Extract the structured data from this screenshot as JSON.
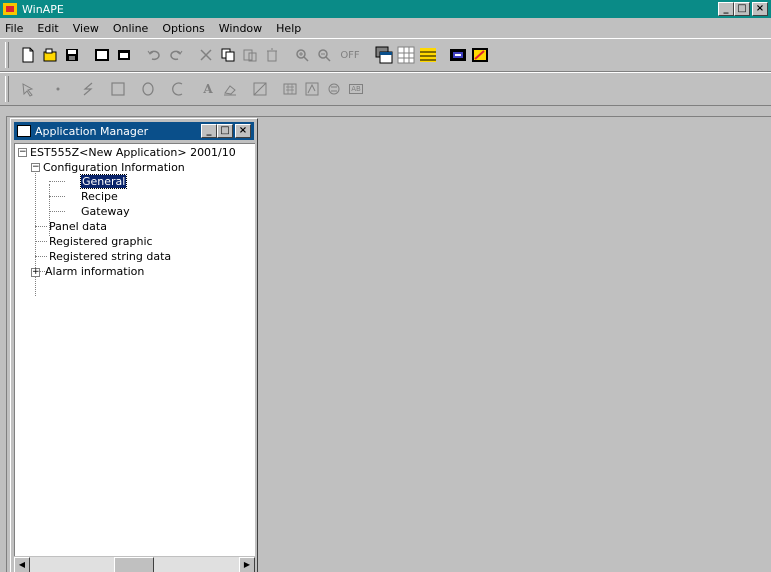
{
  "window": {
    "title": "WinAPE"
  },
  "menu": [
    "File",
    "Edit",
    "View",
    "Online",
    "Options",
    "Window",
    "Help"
  ],
  "toolbar1": [
    {
      "name": "new-icon"
    },
    {
      "name": "open-icon"
    },
    {
      "name": "save-icon"
    },
    {
      "name": "screen-icon"
    },
    {
      "name": "dialog-icon"
    },
    {
      "name": "undo-icon"
    },
    {
      "name": "redo-icon"
    },
    {
      "name": "cut-icon"
    },
    {
      "name": "copy-icon"
    },
    {
      "name": "paste-icon"
    },
    {
      "name": "delete-icon"
    },
    {
      "name": "zoom-in-icon"
    },
    {
      "name": "zoom-out-icon"
    },
    {
      "name": "zoom-off-icon",
      "label": "OFF"
    },
    {
      "name": "overlap-icon"
    },
    {
      "name": "grid-icon"
    },
    {
      "name": "palette-icon"
    },
    {
      "name": "screen-list-icon"
    },
    {
      "name": "property-icon"
    }
  ],
  "toolbar2": [
    {
      "name": "select-arrow-icon"
    },
    {
      "name": "dot-icon"
    },
    {
      "name": "polyline-icon"
    },
    {
      "name": "rectangle-icon"
    },
    {
      "name": "circle-icon"
    },
    {
      "name": "arc-icon"
    },
    {
      "name": "text-icon",
      "label": "A"
    },
    {
      "name": "paint-icon"
    },
    {
      "name": "slash-box-icon"
    },
    {
      "name": "keyboard-icon"
    },
    {
      "name": "lamp-icon"
    },
    {
      "name": "numeric-icon"
    },
    {
      "name": "ascii-icon",
      "label": "AB"
    }
  ],
  "app_manager": {
    "title": "Application Manager",
    "tree": {
      "root": "EST555Z<New Application> 2001/10",
      "config": "Configuration Information",
      "general": "General",
      "recipe": "Recipe",
      "gateway": "Gateway",
      "panel": "Panel data",
      "graphic": "Registered graphic",
      "string": "Registered string data",
      "alarm": "Alarm information"
    }
  },
  "colors": {
    "title_active": "#0a8b87",
    "child_title": "#0a4f8a",
    "selection": "#0a246a"
  }
}
